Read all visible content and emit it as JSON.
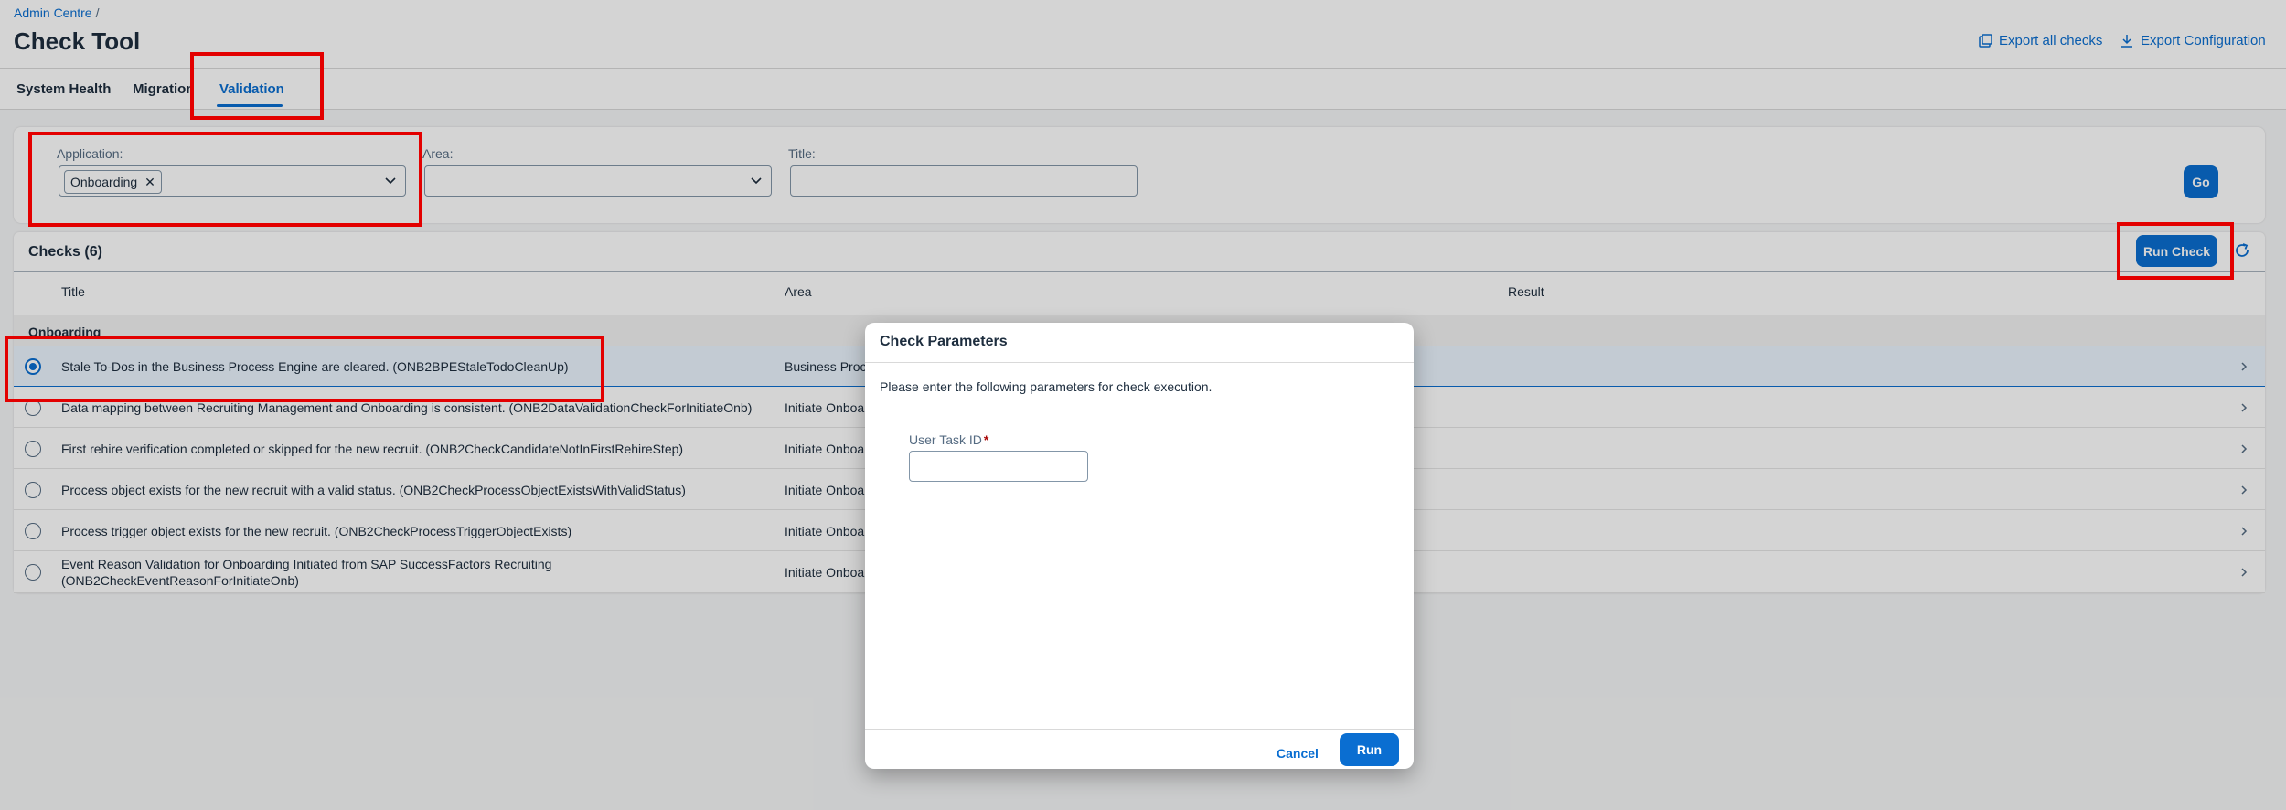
{
  "breadcrumb": {
    "root": "Admin Centre",
    "separator": "/"
  },
  "page": {
    "title": "Check Tool"
  },
  "header_actions": {
    "export_all": "Export all checks",
    "export_config": "Export Configuration"
  },
  "tabs": [
    {
      "label": "System Health"
    },
    {
      "label": "Migration"
    },
    {
      "label": "Validation",
      "active": true
    }
  ],
  "filters": {
    "application": {
      "label": "Application:",
      "token": "Onboarding"
    },
    "area": {
      "label": "Area:",
      "value": ""
    },
    "title": {
      "label": "Title:",
      "value": ""
    },
    "go_label": "Go"
  },
  "table": {
    "title": "Checks (6)",
    "run_check_label": "Run Check",
    "columns": {
      "title": "Title",
      "area": "Area",
      "result": "Result"
    },
    "group": "Onboarding",
    "rows": [
      {
        "title": "Stale To-Dos in the Business Process Engine are cleared. (ONB2BPEStaleTodoCleanUp)",
        "area": "Business Proce",
        "selected": true
      },
      {
        "title": "Data mapping between Recruiting Management and Onboarding is consistent. (ONB2DataValidationCheckForInitiateOnb)",
        "area": "Initiate Onboa",
        "selected": false
      },
      {
        "title": "First rehire verification completed or skipped for the new recruit. (ONB2CheckCandidateNotInFirstRehireStep)",
        "area": "Initiate Onboa",
        "selected": false
      },
      {
        "title": "Process object exists for the new recruit with a valid status. (ONB2CheckProcessObjectExistsWithValidStatus)",
        "area": "Initiate Onboa",
        "selected": false
      },
      {
        "title": "Process trigger object exists for the new recruit. (ONB2CheckProcessTriggerObjectExists)",
        "area": "Initiate Onboa",
        "selected": false
      },
      {
        "title_line1": "Event Reason Validation for Onboarding Initiated from SAP SuccessFactors Recruiting",
        "title_line2": "(ONB2CheckEventReasonForInitiateOnb)",
        "area": "Initiate Onboa",
        "selected": false
      }
    ]
  },
  "dialog": {
    "title": "Check Parameters",
    "message": "Please enter the following parameters for check execution.",
    "field_label": "User Task ID",
    "required_mark": "*",
    "field_value": "",
    "cancel_label": "Cancel",
    "run_label": "Run"
  },
  "colors": {
    "accent": "#0a6ed1",
    "highlight": "#e30000"
  }
}
